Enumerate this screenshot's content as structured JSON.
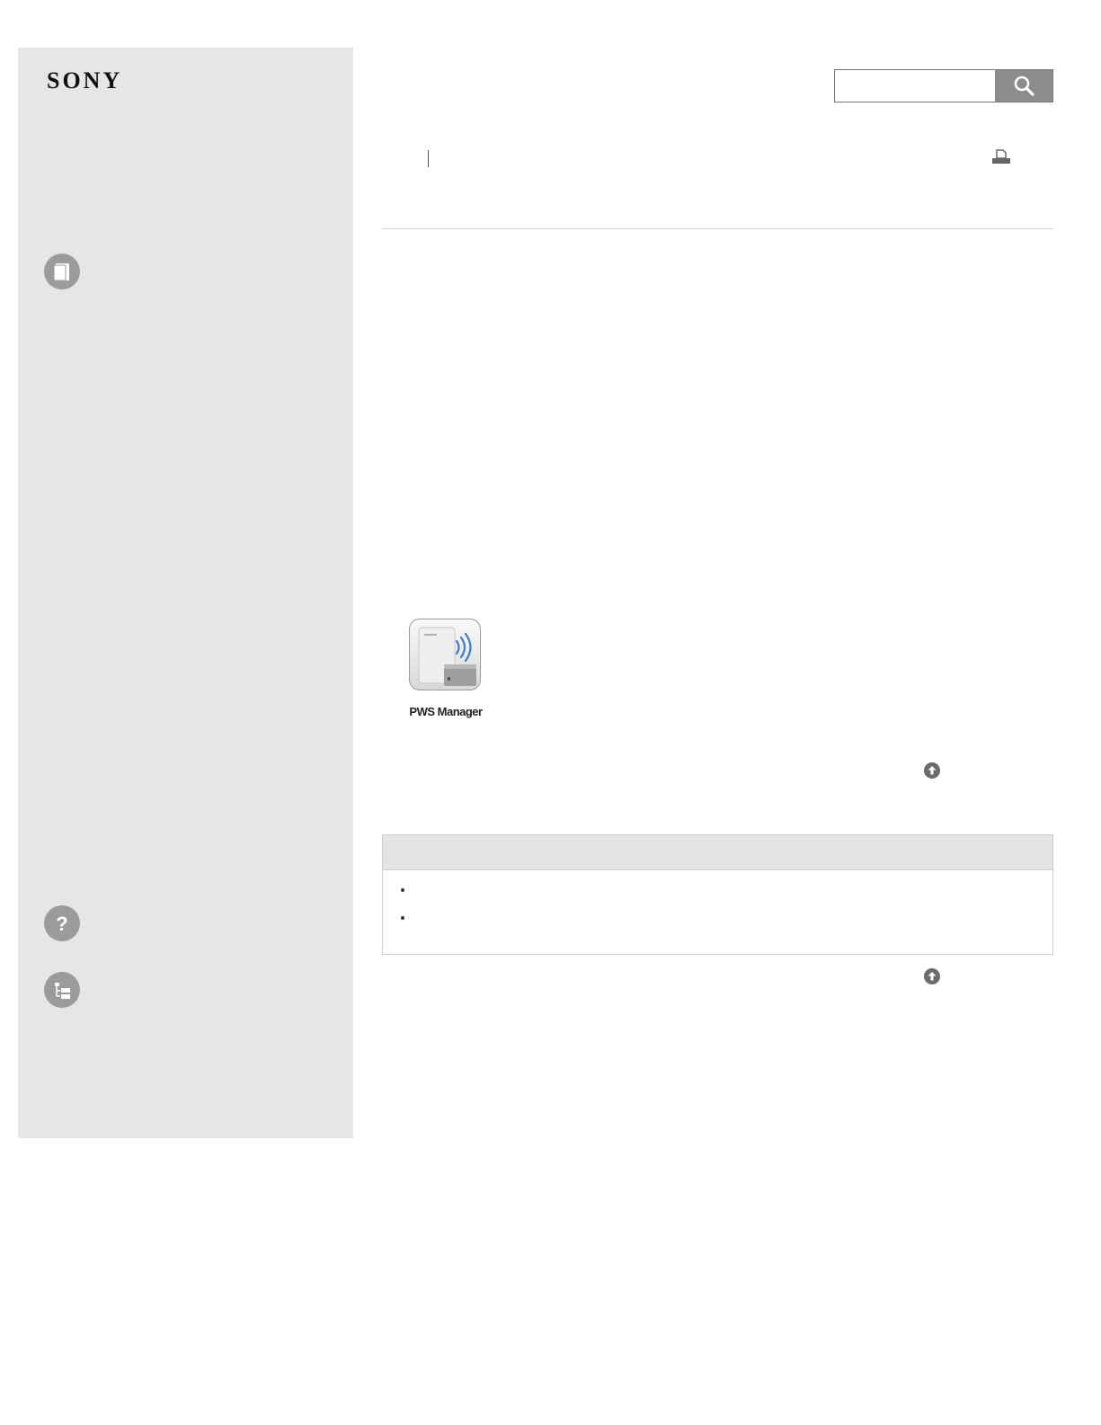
{
  "brand": {
    "logo_text": "SONY"
  },
  "sidebar": {
    "icons": [
      "manual-book-icon",
      "help-question-icon",
      "site-map-icon"
    ]
  },
  "search": {
    "placeholder": "",
    "value": ""
  },
  "app_tile": {
    "label": "PWS Manager",
    "icon": "pws-manager-app-icon"
  },
  "navigation": {
    "back_to_top_icon": "arrow-up-circle-icon",
    "print_icon": "printer-icon"
  },
  "related": {
    "items": [
      "",
      ""
    ]
  },
  "colors": {
    "sidebar_bg": "#e6e6e6",
    "search_button": "#8c8c8c",
    "related_header_bg": "#e4e4e4"
  }
}
